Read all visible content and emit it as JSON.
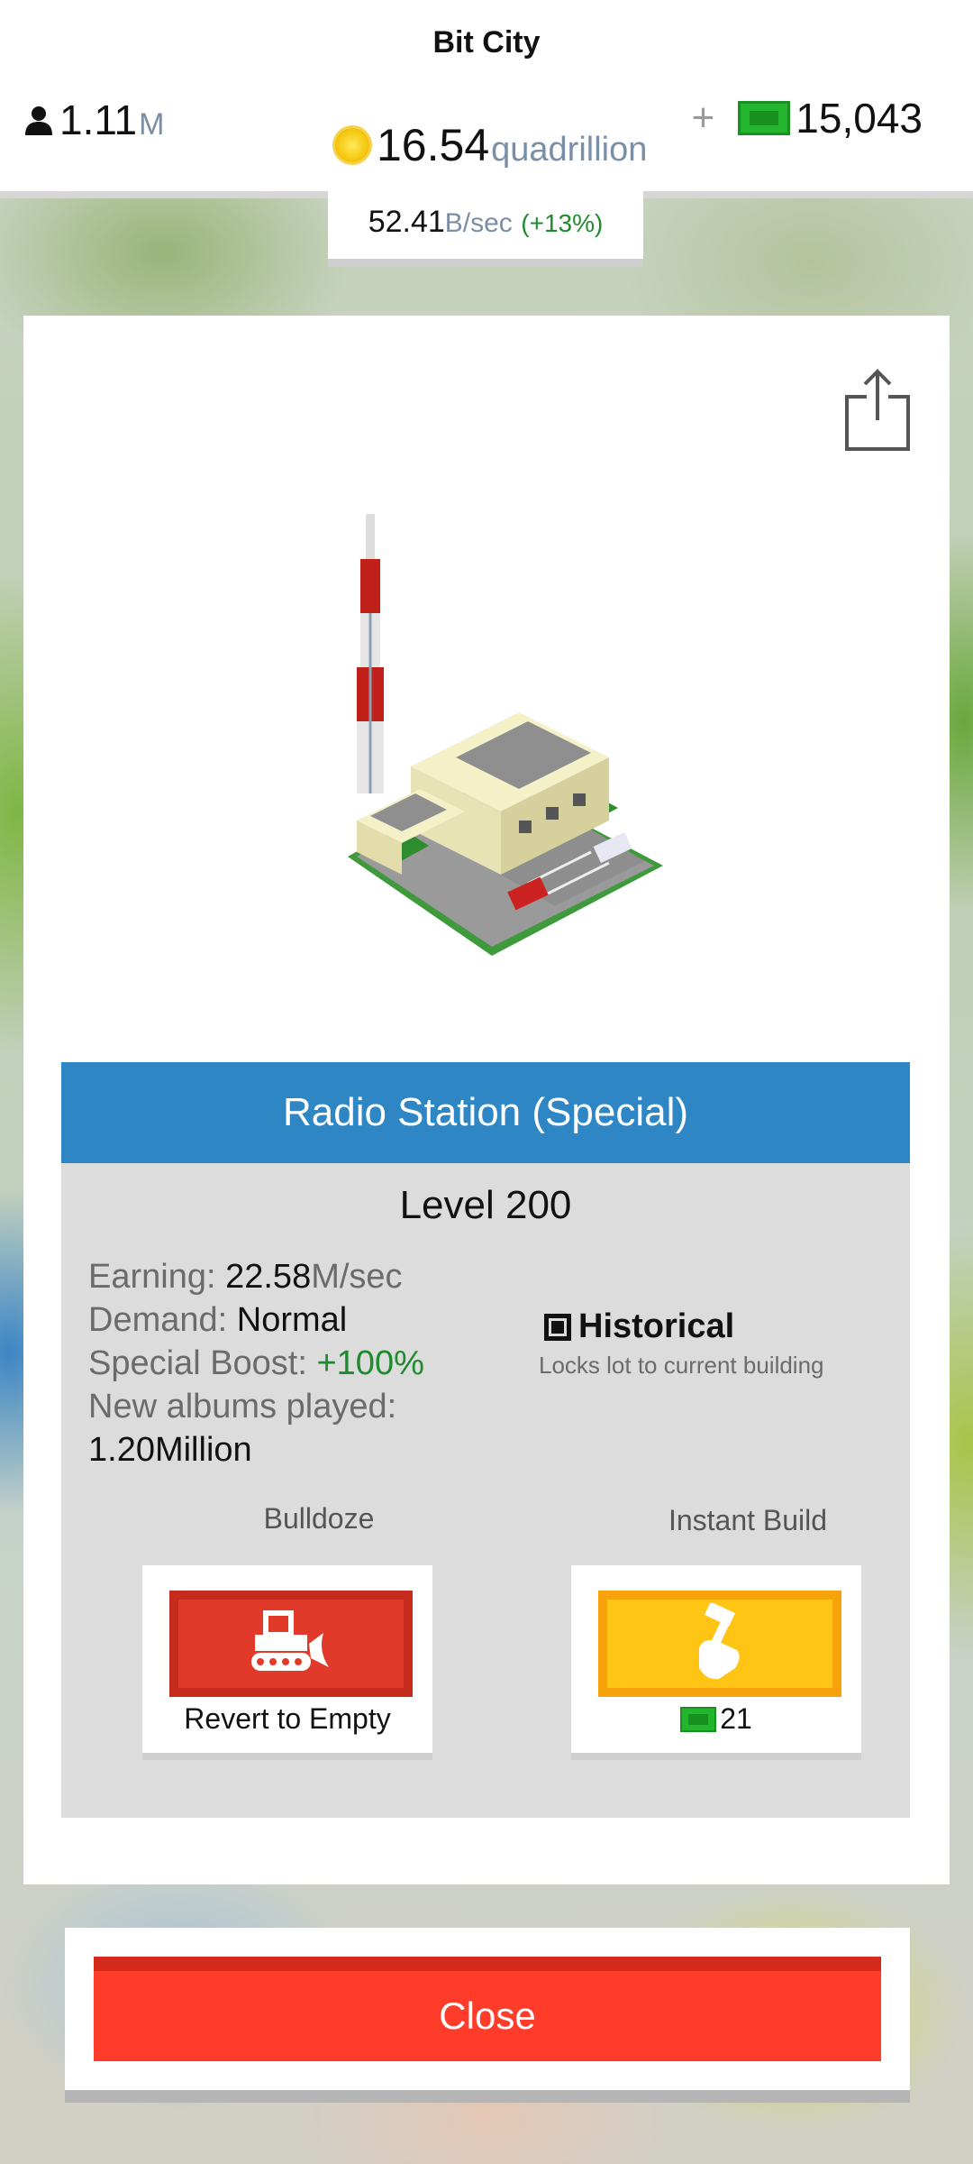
{
  "header": {
    "title": "Bit City",
    "population": {
      "value": "1.11",
      "unit": "M"
    },
    "coins": {
      "value": "16.54",
      "unit": "quadrillion"
    },
    "cash": {
      "plus": "+",
      "value": "15,043"
    },
    "rate": {
      "value": "52.41",
      "unit": "B/sec",
      "bonus": "(+13%)"
    }
  },
  "building": {
    "name": "Radio Station (Special)",
    "level": "Level 200",
    "stats": {
      "earning_label": "Earning:",
      "earning_value": "22.58",
      "earning_unit": "M/sec",
      "demand_label": "Demand:",
      "demand_value": "Normal",
      "boost_label": "Special Boost:",
      "boost_value": "+100%",
      "albums_label": "New albums played:",
      "albums_value": "1.20Million"
    },
    "historical": {
      "label": "Historical",
      "description": "Locks lot to current building",
      "checked": true
    }
  },
  "actions": {
    "bulldoze": {
      "label": "Bulldoze",
      "caption": "Revert to Empty",
      "color": "#e13a2a"
    },
    "instant_build": {
      "label": "Instant Build",
      "cost": "21",
      "color": "#ffc414"
    }
  },
  "close_label": "Close",
  "icons": {
    "population": "person-icon",
    "coin": "coin-icon",
    "cash": "cash-bill-icon",
    "share": "share-icon",
    "bulldozer": "bulldozer-icon",
    "build": "hammer-hand-icon"
  },
  "colors": {
    "header_blue": "#2e86c4",
    "close_red": "#ff3b2a",
    "positive_green": "#1f8a2e"
  }
}
